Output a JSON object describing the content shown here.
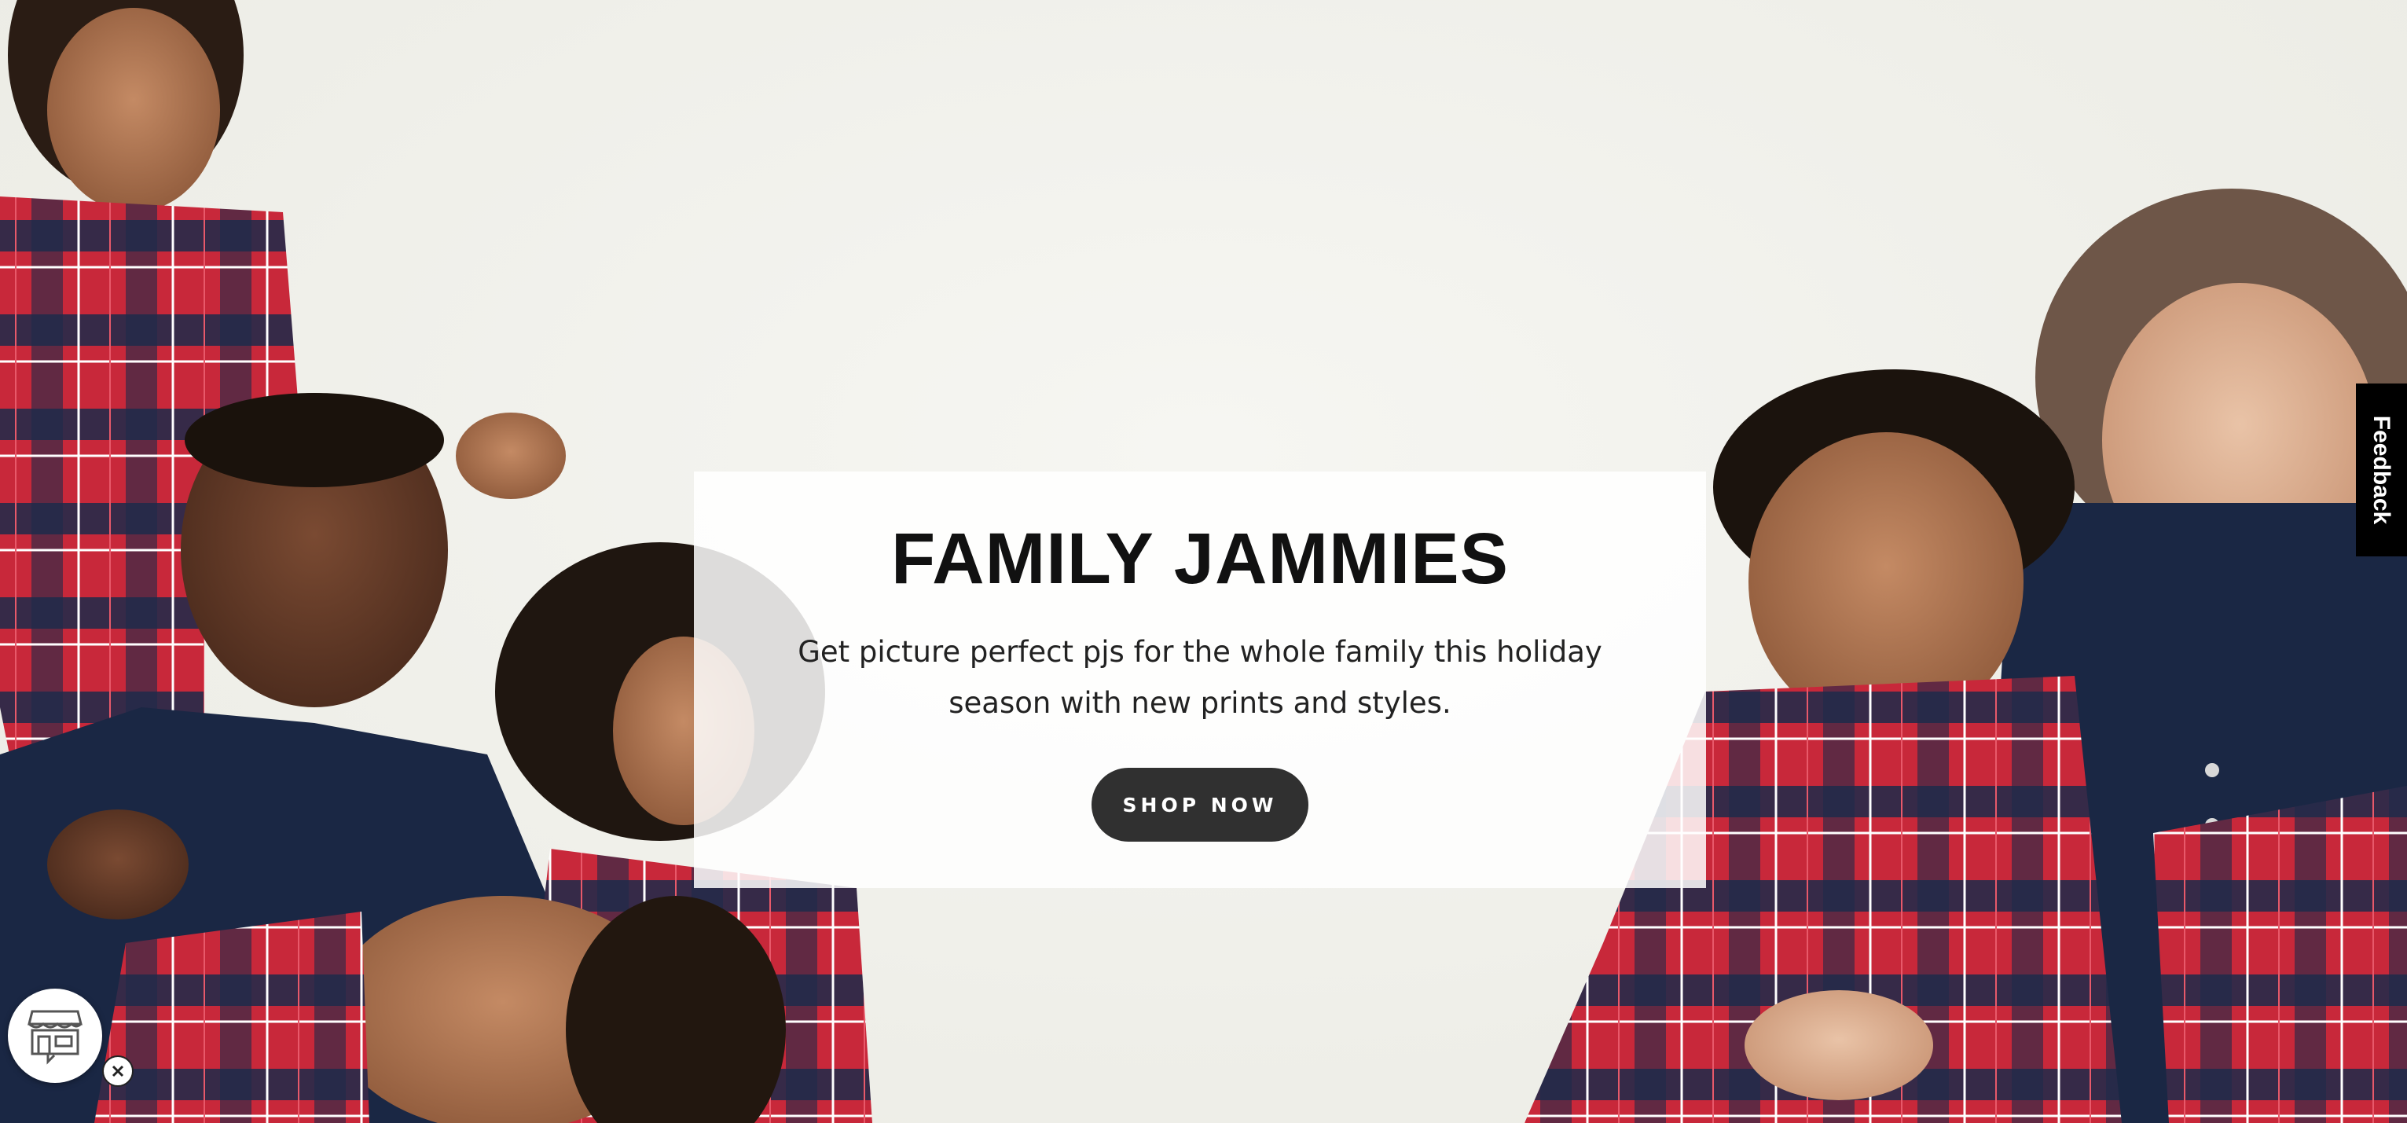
{
  "hero": {
    "title": "FAMILY JAMMIES",
    "subtitle": "Get picture perfect pjs for the whole family this holiday season with new prints and styles.",
    "cta_label": "SHOP NOW"
  },
  "feedback": {
    "label": "Feedback"
  },
  "store_widget": {
    "icon": "storefront-icon",
    "close_icon": "close-icon"
  },
  "colors": {
    "plaid_red": "#c8283a",
    "plaid_navy": "#1c2a4a",
    "button_bg": "#303030",
    "feedback_bg": "#000000"
  }
}
